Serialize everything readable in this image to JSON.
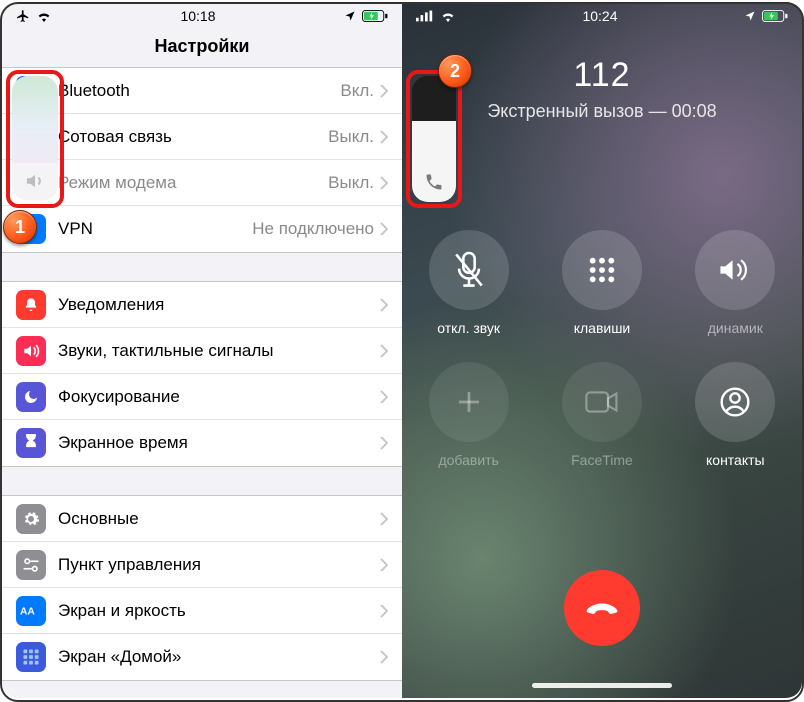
{
  "phone1": {
    "status": {
      "time": "10:18"
    },
    "title": "Настройки",
    "group1": [
      {
        "key": "bluetooth",
        "icon": "bluetooth",
        "bg": "#007aff",
        "label": "Bluetooth",
        "value": "Вкл."
      },
      {
        "key": "cellular",
        "icon": "antenna",
        "bg": "#34c759",
        "label": "Сотовая связь",
        "value": "Выкл."
      },
      {
        "key": "hotspot",
        "icon": "link",
        "bg": "#34c759",
        "label": "Режим модема",
        "value": "Выкл.",
        "dimmed": true
      },
      {
        "key": "vpn",
        "icon": "vpn",
        "bg": "#007aff",
        "label": "VPN",
        "value": "Не подключено"
      }
    ],
    "group2": [
      {
        "key": "notifications",
        "icon": "bell",
        "bg": "#ff3b30",
        "label": "Уведомления"
      },
      {
        "key": "sounds",
        "icon": "sound",
        "bg": "#ff2d55",
        "label": "Звуки, тактильные сигналы"
      },
      {
        "key": "focus",
        "icon": "moon",
        "bg": "#5856d6",
        "label": "Фокусирование"
      },
      {
        "key": "screentime",
        "icon": "hourglass",
        "bg": "#5856d6",
        "label": "Экранное время"
      }
    ],
    "group3": [
      {
        "key": "general",
        "icon": "gear",
        "bg": "#8e8e93",
        "label": "Основные"
      },
      {
        "key": "control",
        "icon": "switches",
        "bg": "#8e8e93",
        "label": "Пункт управления"
      },
      {
        "key": "display",
        "icon": "aa",
        "bg": "#007aff",
        "label": "Экран и яркость"
      },
      {
        "key": "home",
        "icon": "grid",
        "bg": "#3b5bdb",
        "label": "Экран «Домой»"
      }
    ],
    "annotation": "1"
  },
  "phone2": {
    "status": {
      "time": "10:24"
    },
    "number": "112",
    "subtitle": "Экстренный вызов — 00:08",
    "buttons": {
      "mute": "откл. звук",
      "keypad": "клавиши",
      "speaker": "динамик",
      "add": "добавить",
      "facetime": "FaceTime",
      "contacts": "контакты"
    },
    "annotation": "2"
  }
}
